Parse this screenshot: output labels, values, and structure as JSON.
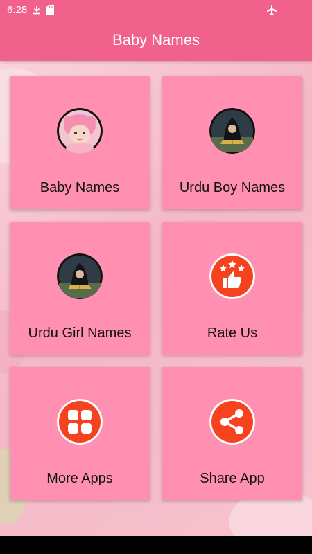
{
  "status_bar": {
    "time": "6:28",
    "icons": [
      "download-icon",
      "sd-card-icon",
      "airplane-mode-icon"
    ]
  },
  "app_bar": {
    "title": "Baby Names"
  },
  "menu": [
    {
      "label": "Baby Names",
      "icon": "baby-photo-icon"
    },
    {
      "label": "Urdu Boy Names",
      "icon": "child-reading-quran-icon"
    },
    {
      "label": "Urdu Girl Names",
      "icon": "child-reading-quran-icon"
    },
    {
      "label": "Rate Us",
      "icon": "rate-stars-thumbs-up-icon"
    },
    {
      "label": "More Apps",
      "icon": "apps-grid-icon"
    },
    {
      "label": "Share App",
      "icon": "share-icon"
    }
  ],
  "colors": {
    "primary": "#f0618c",
    "card": "#ff90b1",
    "icon_red": "#f4431e"
  }
}
